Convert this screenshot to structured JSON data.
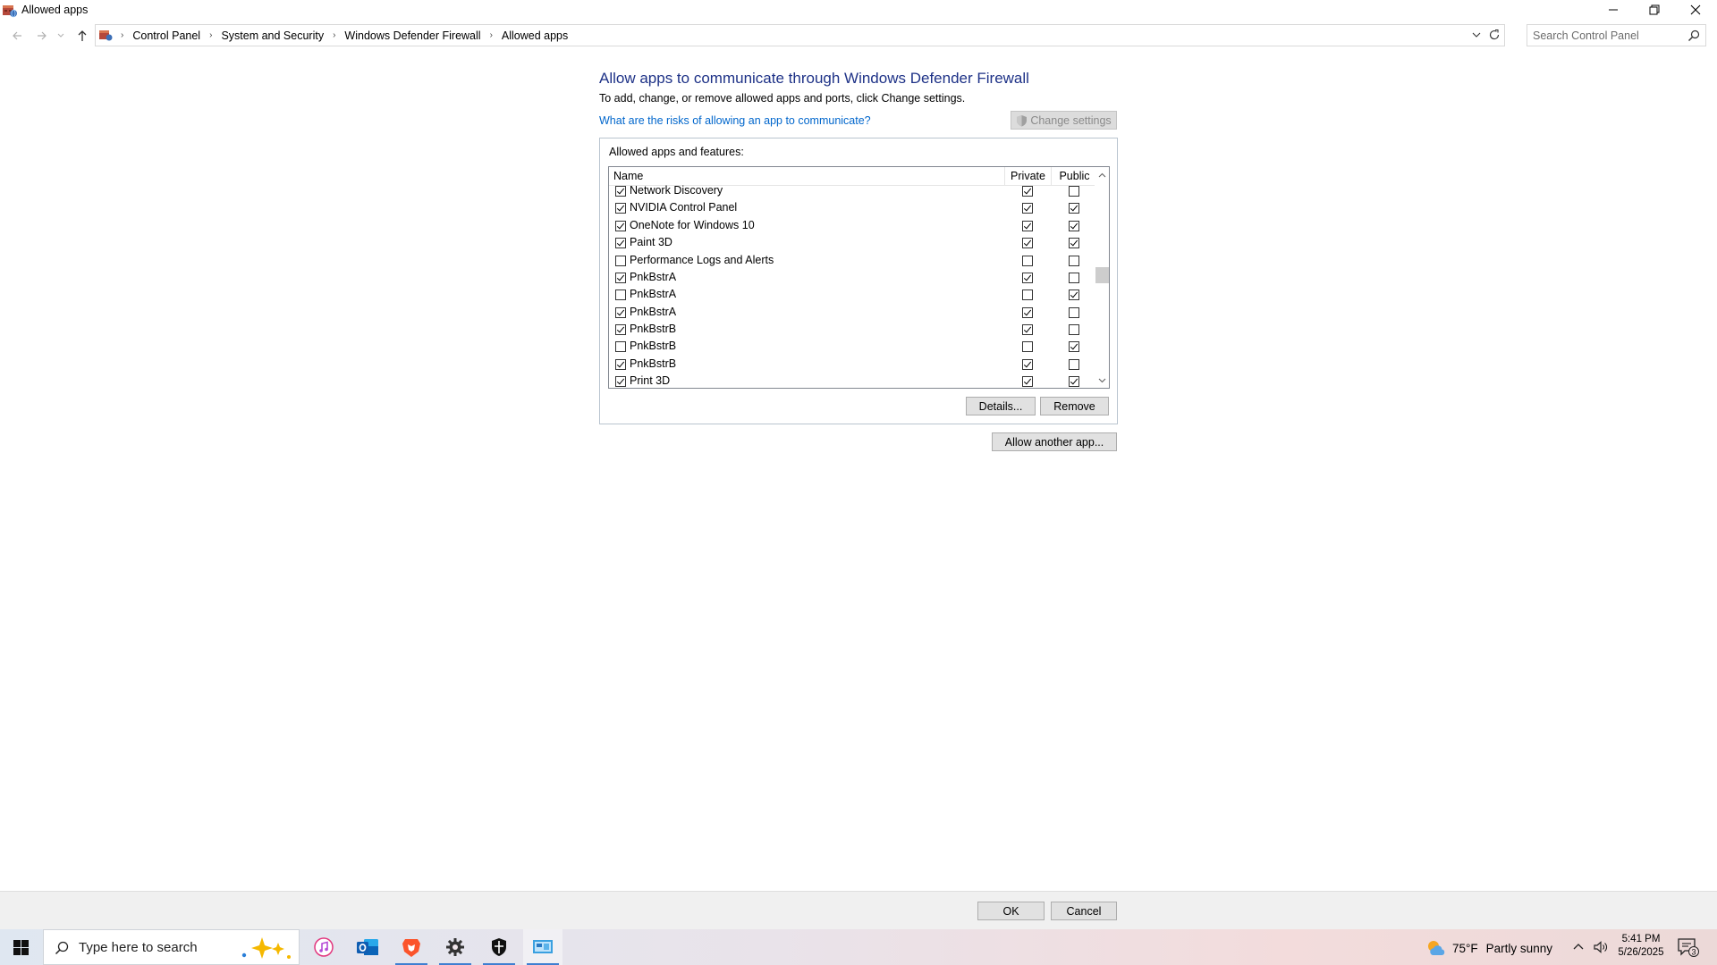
{
  "window": {
    "title": "Allowed apps"
  },
  "breadcrumb": [
    "Control Panel",
    "System and Security",
    "Windows Defender Firewall",
    "Allowed apps"
  ],
  "search": {
    "placeholder": "Search Control Panel"
  },
  "main": {
    "heading": "Allow apps to communicate through Windows Defender Firewall",
    "subtext": "To add, change, or remove allowed apps and ports, click Change settings.",
    "risk_link": "What are the risks of allowing an app to communicate?",
    "change_settings": "Change settings",
    "group_label": "Allowed apps and features:",
    "columns": {
      "name": "Name",
      "private": "Private",
      "public": "Public"
    },
    "rows": [
      {
        "name": "Network Discovery",
        "enabled": true,
        "private": true,
        "public": false
      },
      {
        "name": "NVIDIA Control Panel",
        "enabled": true,
        "private": true,
        "public": true
      },
      {
        "name": "OneNote for Windows 10",
        "enabled": true,
        "private": true,
        "public": true
      },
      {
        "name": "Paint 3D",
        "enabled": true,
        "private": true,
        "public": true
      },
      {
        "name": "Performance Logs and Alerts",
        "enabled": false,
        "private": false,
        "public": false
      },
      {
        "name": "PnkBstrA",
        "enabled": true,
        "private": true,
        "public": false
      },
      {
        "name": "PnkBstrA",
        "enabled": false,
        "private": false,
        "public": true
      },
      {
        "name": "PnkBstrA",
        "enabled": true,
        "private": true,
        "public": false
      },
      {
        "name": "PnkBstrB",
        "enabled": true,
        "private": true,
        "public": false
      },
      {
        "name": "PnkBstrB",
        "enabled": false,
        "private": false,
        "public": true
      },
      {
        "name": "PnkBstrB",
        "enabled": true,
        "private": true,
        "public": false
      },
      {
        "name": "Print 3D",
        "enabled": true,
        "private": true,
        "public": true
      }
    ],
    "details_button": "Details...",
    "remove_button": "Remove",
    "allow_another_button": "Allow another app..."
  },
  "footer": {
    "ok": "OK",
    "cancel": "Cancel"
  },
  "taskbar": {
    "search_placeholder": "Type here to search",
    "pinned_apps": [
      "itunes-icon",
      "outlook-icon",
      "brave-icon",
      "settings-icon",
      "security-shield-icon",
      "control-panel-icon"
    ],
    "active_app": "control-panel-icon",
    "weather": {
      "temp": "75°F",
      "condition": "Partly sunny"
    },
    "clock": {
      "time": "5:41 PM",
      "date": "5/26/2025"
    },
    "notifications": "3"
  },
  "colors": {
    "heading": "#1e3287",
    "link": "#0066cc",
    "accent": "#3f7fd1"
  }
}
